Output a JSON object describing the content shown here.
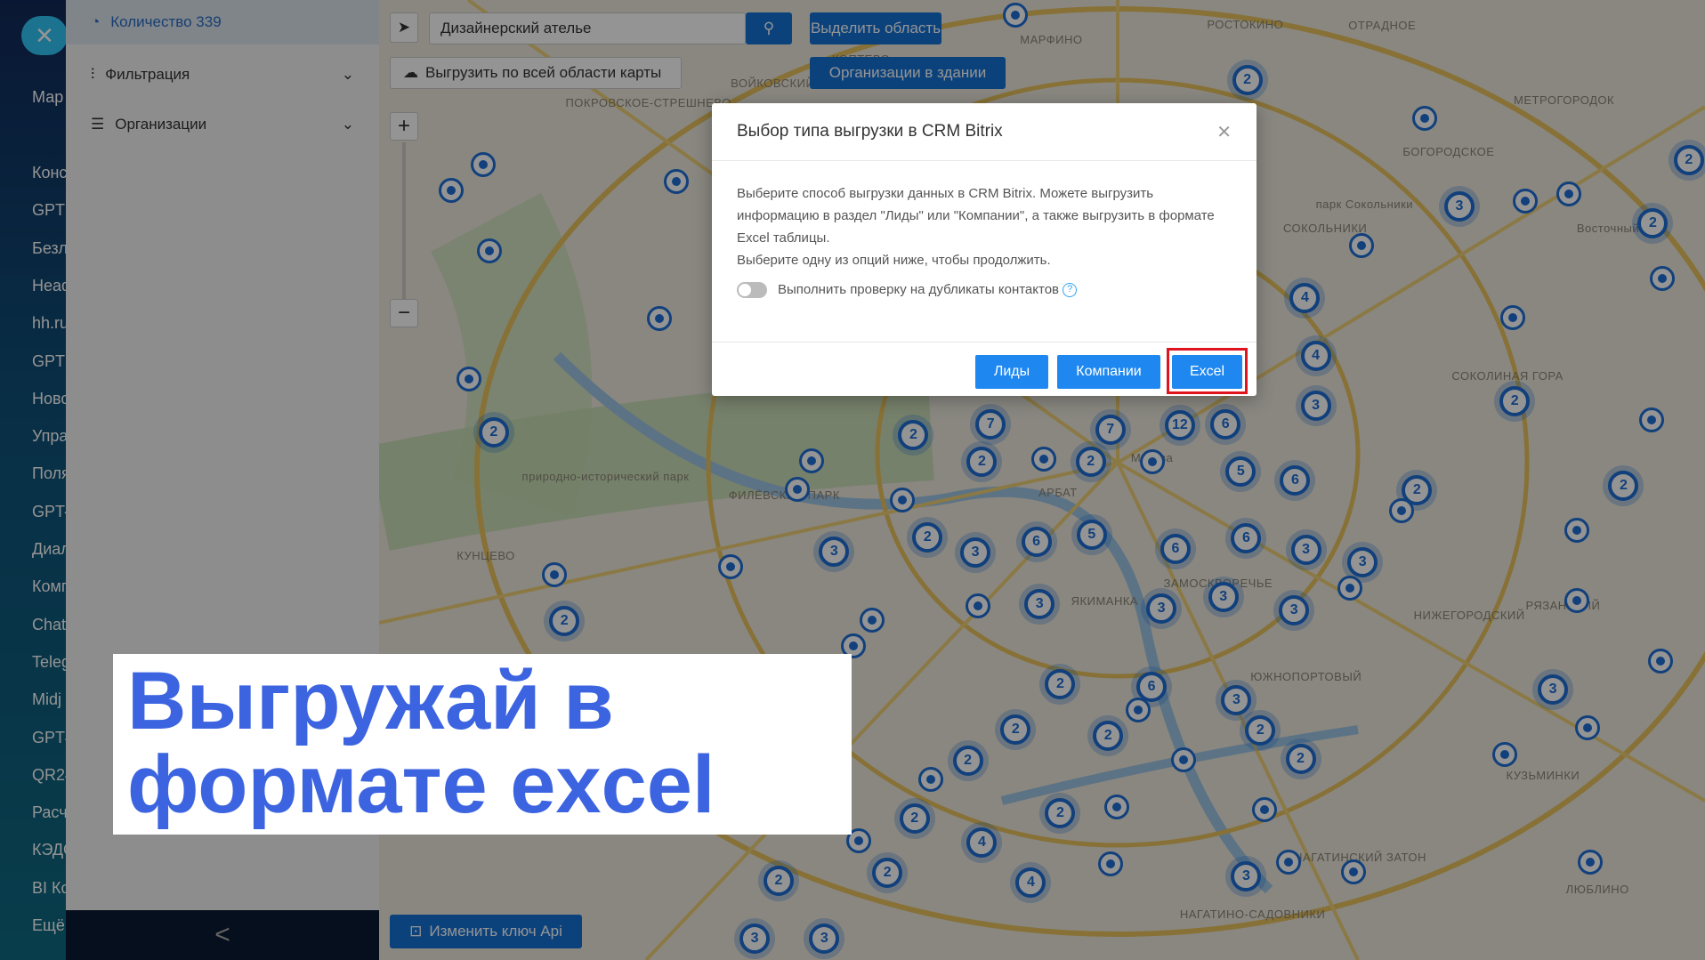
{
  "left_nav": {
    "items": [
      "Мар",
      "Конс",
      "GPT",
      "Безл",
      "Head",
      "hh.ru",
      "GPT",
      "Ново",
      "Упра",
      "Поля",
      "GPT-",
      "Диал",
      "Комп",
      "Chat",
      "Teleg",
      "Midj",
      "GPT4",
      "QR24",
      "Расч",
      "КЭДО",
      "BI Ко",
      "Ещё"
    ]
  },
  "panel": {
    "count_label": "Количество 339",
    "filter_label": "Фильтрация",
    "orgs_label": "Организации",
    "collapse_icon": "<"
  },
  "map": {
    "search_value": "Дизайнерский ателье",
    "select_area_label": "Выделить область",
    "export_all_label": "Выгрузить по всей области карты",
    "orgs_in_building_label": "Организации в здании",
    "change_api_key_label": "Изменить ключ Api",
    "zoom_in": "+",
    "zoom_out": "−",
    "clusters": [
      "2",
      "3",
      "2",
      "2",
      "4",
      "4",
      "3",
      "2",
      "2",
      "2",
      "2",
      "2",
      "7",
      "7",
      "12",
      "6",
      "2",
      "2",
      "2",
      "5",
      "6",
      "3",
      "2",
      "3",
      "6",
      "5",
      "6",
      "6",
      "3",
      "3",
      "3",
      "3",
      "3",
      "3",
      "2",
      "6",
      "3",
      "2",
      "2",
      "2",
      "2",
      "2",
      "3",
      "2",
      "4",
      "2",
      "2",
      "3",
      "3",
      "3",
      "2",
      "4"
    ],
    "labels": [
      "РОСТОКИНО",
      "МАРФИНО",
      "КОПТЕВО",
      "ВОЙКОВСКИЙ",
      "ПОКРОВСКОЕ-СТРЕШНЕВО",
      "БОГОРОДСКОЕ",
      "СОКОЛЬНИКИ",
      "МЕТРОГОРОДОК",
      "парк Сокольники",
      "Восточный вкз.",
      "СОКОЛИНАЯ ГОРА",
      "природно-исторический парк",
      "ФИЛЁВСКИЙ ПАРК",
      "КУНЦЕВО",
      "АРБАТ",
      "Москва",
      "ЯКИМАНКА",
      "ЗАМОСКВОРЕЧЬЕ",
      "НИЖЕГОРОДСКИЙ",
      "РЯЗАНСКИЙ",
      "ЮЖНОПОРТОВЫЙ",
      "КУЗЬМИНКИ",
      "НАГАТИНСКИЙ ЗАТОН",
      "ЛЮБЛИНО",
      "НАГАТИНО-САДОВНИКИ",
      "ОТРАДНОЕ"
    ]
  },
  "dialog": {
    "title": "Выбор типа выгрузки в CRM Bitrix",
    "body1": "Выберите способ выгрузки данных в CRM Bitrix. Можете выгрузить информацию в раздел \"Лиды\" или \"Компании\", а также выгрузить в формате Excel таблицы.",
    "body2": "Выберите одну из опций ниже, чтобы продолжить.",
    "toggle_label": "Выполнить проверку на дубликаты контактов",
    "help_icon": "?",
    "close_icon": "✕",
    "buttons": {
      "leads": "Лиды",
      "companies": "Компании",
      "excel": "Excel"
    },
    "highlight_color": "#e0141e"
  },
  "banner": {
    "line1": "Выгружай в",
    "line2": "формате excel"
  }
}
